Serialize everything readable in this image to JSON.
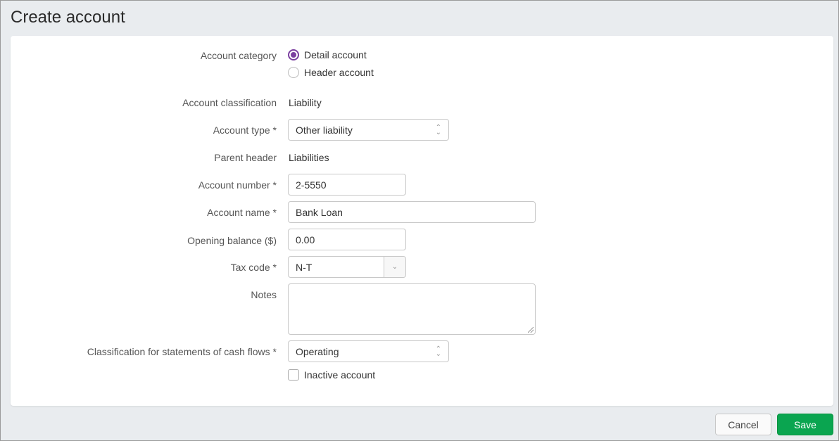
{
  "page": {
    "title": "Create account"
  },
  "form": {
    "account_category": {
      "label": "Account category",
      "options": [
        {
          "label": "Detail account",
          "selected": true
        },
        {
          "label": "Header account",
          "selected": false
        }
      ]
    },
    "account_classification": {
      "label": "Account classification",
      "value": "Liability"
    },
    "account_type": {
      "label": "Account type *",
      "value": "Other liability"
    },
    "parent_header": {
      "label": "Parent header",
      "value": "Liabilities"
    },
    "account_number": {
      "label": "Account number *",
      "value": "2-5550"
    },
    "account_name": {
      "label": "Account name *",
      "value": "Bank Loan"
    },
    "opening_balance": {
      "label": "Opening balance ($)",
      "value": "0.00"
    },
    "tax_code": {
      "label": "Tax code *",
      "value": "N-T"
    },
    "notes": {
      "label": "Notes",
      "value": ""
    },
    "cash_flow_classification": {
      "label": "Classification for statements of cash flows *",
      "value": "Operating"
    },
    "inactive": {
      "label": "Inactive account",
      "checked": false
    }
  },
  "icons": {
    "select_chevron_up": "⌃",
    "select_chevron_down": "⌄",
    "dropdown_chevron": "⌄"
  },
  "actions": {
    "cancel_label": "Cancel",
    "save_label": "Save"
  },
  "colors": {
    "accent": "#7b3fa0",
    "save": "#0aa550",
    "background": "#e9ecef"
  }
}
